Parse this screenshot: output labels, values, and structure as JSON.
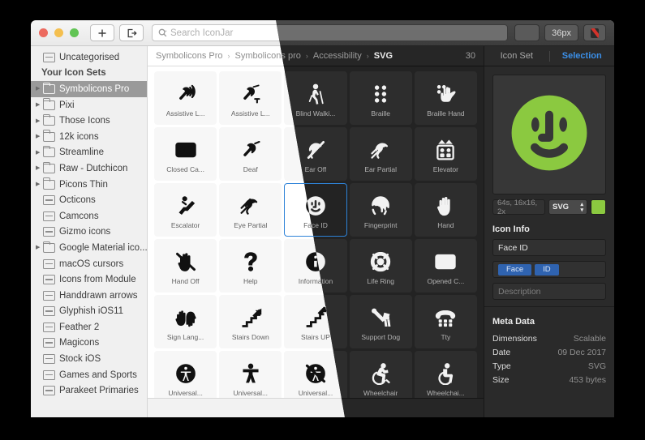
{
  "window": {
    "traffic_lights": [
      "close",
      "minimize",
      "zoom"
    ],
    "add_button_label": "+",
    "export_button_name": "export"
  },
  "search": {
    "placeholder": "Search IconJar",
    "value": ""
  },
  "toolbar": {
    "filter_label": "filter-sort",
    "size_label": "36px",
    "color_label": "color-swatch",
    "swatch_color": "#d3322a"
  },
  "sidebar": {
    "items": [
      {
        "label": "Uncategorised",
        "icon": "set-icon",
        "arrow": false,
        "selected": false,
        "section": false
      },
      {
        "label": "Your Icon Sets",
        "icon": "none",
        "arrow": false,
        "selected": false,
        "section": true
      },
      {
        "label": "Symbolicons Pro",
        "icon": "folder-icon",
        "arrow": true,
        "selected": true,
        "section": false
      },
      {
        "label": "Pixi",
        "icon": "folder-icon",
        "arrow": true,
        "selected": false,
        "section": false
      },
      {
        "label": "Those Icons",
        "icon": "folder-icon",
        "arrow": true,
        "selected": false,
        "section": false
      },
      {
        "label": "12k icons",
        "icon": "folder-icon",
        "arrow": true,
        "selected": false,
        "section": false
      },
      {
        "label": "Streamline",
        "icon": "folder-icon",
        "arrow": true,
        "selected": false,
        "section": false
      },
      {
        "label": "Raw - Dutchicon",
        "icon": "folder-icon",
        "arrow": true,
        "selected": false,
        "section": false
      },
      {
        "label": "Picons Thin",
        "icon": "folder-icon",
        "arrow": true,
        "selected": false,
        "section": false
      },
      {
        "label": "Octicons",
        "icon": "set-icon",
        "arrow": false,
        "selected": false,
        "section": false
      },
      {
        "label": "Camcons",
        "icon": "set-icon",
        "arrow": false,
        "selected": false,
        "section": false
      },
      {
        "label": "Gizmo icons",
        "icon": "set-icon",
        "arrow": false,
        "selected": false,
        "section": false
      },
      {
        "label": "Google Material ico...",
        "icon": "folder-icon",
        "arrow": true,
        "selected": false,
        "section": false
      },
      {
        "label": "macOS cursors",
        "icon": "set-icon",
        "arrow": false,
        "selected": false,
        "section": false
      },
      {
        "label": "Icons from Module",
        "icon": "set-icon",
        "arrow": false,
        "selected": false,
        "section": false
      },
      {
        "label": "Handdrawn arrows",
        "icon": "set-icon",
        "arrow": false,
        "selected": false,
        "section": false
      },
      {
        "label": "Glyphish iOS11",
        "icon": "set-icon",
        "arrow": false,
        "selected": false,
        "section": false
      },
      {
        "label": "Feather 2",
        "icon": "set-icon",
        "arrow": false,
        "selected": false,
        "section": false
      },
      {
        "label": "Magicons",
        "icon": "set-icon",
        "arrow": false,
        "selected": false,
        "section": false
      },
      {
        "label": "Stock iOS",
        "icon": "set-icon",
        "arrow": false,
        "selected": false,
        "section": false
      },
      {
        "label": "Games and Sports",
        "icon": "set-icon",
        "arrow": false,
        "selected": false,
        "section": false
      },
      {
        "label": "Parakeet Primaries",
        "icon": "set-icon",
        "arrow": false,
        "selected": false,
        "section": false
      }
    ]
  },
  "breadcrumb": {
    "parts": [
      "Symbolicons Pro",
      "Symbolicons pro",
      "Accessibility",
      "SVG"
    ],
    "separator": "›",
    "count": "30"
  },
  "grid": {
    "icons": [
      {
        "label": "Assistive L...",
        "icon": "assistive-listening-icon"
      },
      {
        "label": "Assistive L...",
        "icon": "assistive-listening-t-icon"
      },
      {
        "label": "Blind Walki...",
        "icon": "blind-walking-icon"
      },
      {
        "label": "Braille",
        "icon": "braille-icon"
      },
      {
        "label": "Braille Hand",
        "icon": "braille-hand-icon"
      },
      {
        "label": "Closed Ca...",
        "icon": "closed-captions-icon"
      },
      {
        "label": "Deaf",
        "icon": "deaf-icon"
      },
      {
        "label": "Ear Off",
        "icon": "ear-off-icon"
      },
      {
        "label": "Ear Partial",
        "icon": "ear-partial-icon"
      },
      {
        "label": "Elevator",
        "icon": "elevator-icon"
      },
      {
        "label": "Escalator",
        "icon": "escalator-icon"
      },
      {
        "label": "Eye Partial",
        "icon": "eye-partial-icon"
      },
      {
        "label": "Face ID",
        "icon": "face-id-icon"
      },
      {
        "label": "Fingerprint",
        "icon": "fingerprint-icon"
      },
      {
        "label": "Hand",
        "icon": "hand-icon"
      },
      {
        "label": "Hand Off",
        "icon": "hand-off-icon"
      },
      {
        "label": "Help",
        "icon": "help-icon"
      },
      {
        "label": "Information",
        "icon": "information-icon"
      },
      {
        "label": "Life Ring",
        "icon": "life-ring-icon"
      },
      {
        "label": "Opened C...",
        "icon": "opened-captions-icon"
      },
      {
        "label": "Sign Lang...",
        "icon": "sign-language-icon"
      },
      {
        "label": "Stairs Down",
        "icon": "stairs-down-icon"
      },
      {
        "label": "Stairs UP",
        "icon": "stairs-up-icon"
      },
      {
        "label": "Support Dog",
        "icon": "support-dog-icon"
      },
      {
        "label": "Tty",
        "icon": "tty-icon"
      },
      {
        "label": "Universal...",
        "icon": "universal-access-circle-icon"
      },
      {
        "label": "Universal...",
        "icon": "universal-access-icon"
      },
      {
        "label": "Universal...",
        "icon": "universal-access-off-icon"
      },
      {
        "label": "Wheelchair",
        "icon": "wheelchair-active-icon"
      },
      {
        "label": "Wheelchai...",
        "icon": "wheelchair-icon"
      }
    ],
    "selected_index": 12
  },
  "inspector": {
    "tabs": [
      {
        "label": "Icon Set",
        "active": false
      },
      {
        "label": "Selection",
        "active": true
      }
    ],
    "preview": {
      "icon": "face-id-icon",
      "color": "#8bc940",
      "info_value": "64s, 16x16, 2x",
      "format": "SVG",
      "chip_color": "#8bc940"
    },
    "icon_info": {
      "title": "Icon Info",
      "name_value": "Face ID",
      "tags": [
        "Face",
        "ID"
      ],
      "description_placeholder": "Description"
    },
    "meta": {
      "title": "Meta Data",
      "rows": [
        {
          "key": "Dimensions",
          "value": "Scalable"
        },
        {
          "key": "Date",
          "value": "09 Dec 2017"
        },
        {
          "key": "Type",
          "value": "SVG"
        },
        {
          "key": "Size",
          "value": "453 bytes"
        }
      ]
    }
  }
}
